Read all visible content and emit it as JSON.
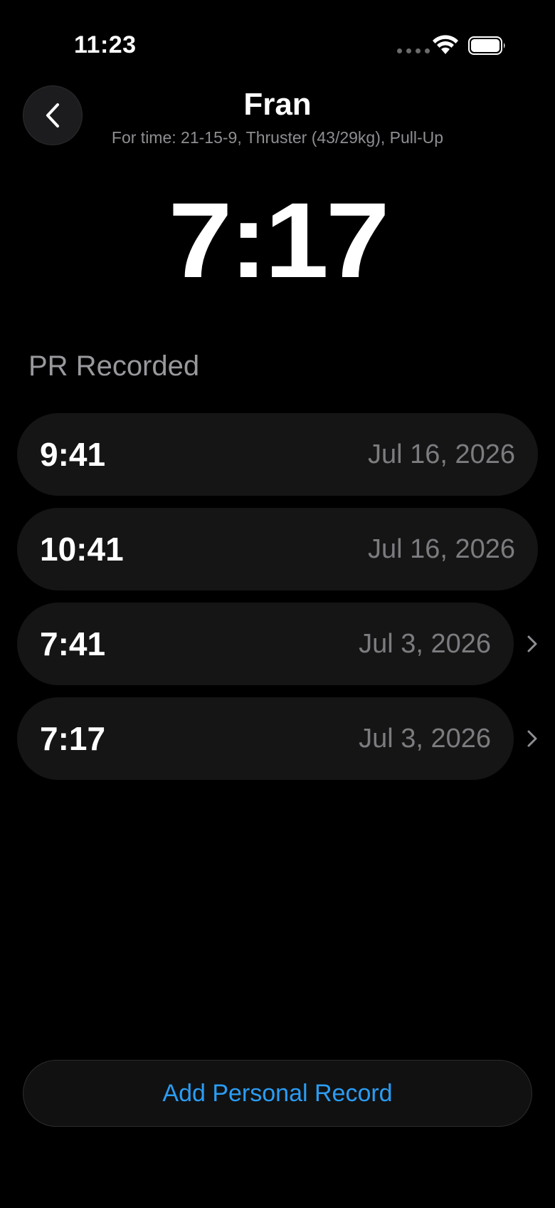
{
  "status_bar": {
    "time": "11:23"
  },
  "header": {
    "title": "Fran",
    "subtitle": "For time: 21-15-9, Thruster (43/29kg), Pull-Up"
  },
  "best_time": "7:17",
  "section_title": "PR Recorded",
  "records": [
    {
      "time": "9:41",
      "date": "Jul 16, 2026",
      "has_chevron": false
    },
    {
      "time": "10:41",
      "date": "Jul 16, 2026",
      "has_chevron": false
    },
    {
      "time": "7:41",
      "date": "Jul 3, 2026",
      "has_chevron": true
    },
    {
      "time": "7:17",
      "date": "Jul 3, 2026",
      "has_chevron": true
    }
  ],
  "add_button_label": "Add Personal Record",
  "colors": {
    "accent": "#2a9df4",
    "background": "#000000",
    "row": "#151515"
  }
}
